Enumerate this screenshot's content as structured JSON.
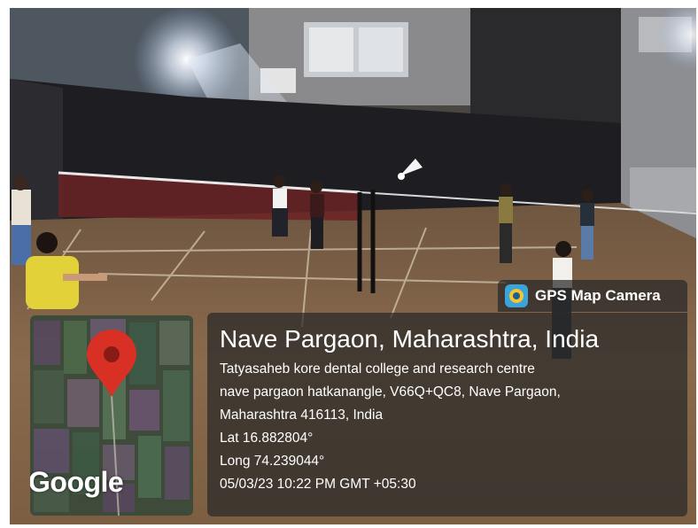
{
  "overlay": {
    "app_label": "GPS Map Camera",
    "app_icon": "gps-map-camera-icon",
    "title": "Nave Pargaon, Maharashtra, India",
    "address_lines": [
      "Tatyasaheb kore dental college and research centre",
      "nave pargaon hatkanangle, V66Q+QC8, Nave Pargaon,",
      "Maharashtra 416113, India"
    ],
    "latitude": "Lat 16.882804°",
    "longitude": "Long 74.239044°",
    "datetime": "05/03/23 10:22 PM GMT +05:30"
  },
  "map": {
    "logo_text": "Google",
    "marker_icon": "map-pin-icon",
    "marker_color": "#d93025"
  },
  "scene": {
    "description_colors": {
      "court": "#8a6a4c",
      "backdrop": "#1e1e22",
      "floodlight": "#ffffff",
      "shirt_yellow": "#e3d13a"
    }
  }
}
